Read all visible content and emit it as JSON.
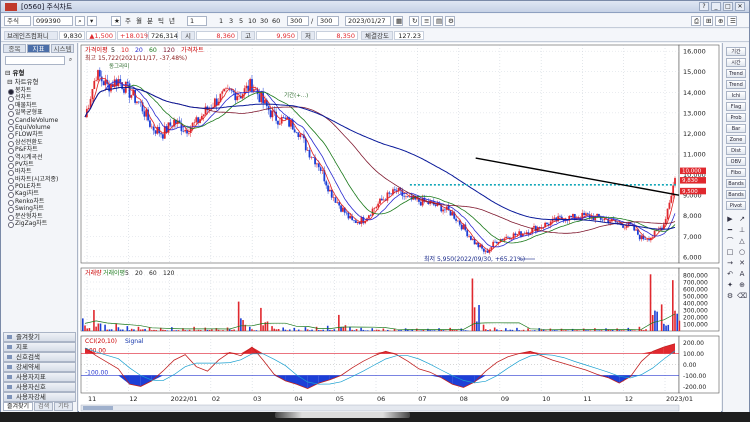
{
  "window": {
    "code": "[0560]",
    "title": "주식차트"
  },
  "toolbar": {
    "market": "주식",
    "stock_code": "099390",
    "period_type": "분",
    "periods": [
      "주",
      "월",
      "분",
      "틱",
      "년"
    ],
    "tick_count": "1",
    "intervals": [
      "1",
      "3",
      "5",
      "10",
      "30",
      "60"
    ],
    "count_value": "300",
    "count_total": "300",
    "date": "2023/01/27"
  },
  "quote": {
    "name": "브레인즈컴퍼니",
    "price": "9,830",
    "change": "▲1,500",
    "change_rate": "+18.01%",
    "volume": "726,314",
    "open_label": "시",
    "open": "8,360",
    "high_label": "고",
    "high": "9,950",
    "low_label": "저",
    "low": "8,350",
    "strength_label": "체결강도",
    "strength": "127.23"
  },
  "left_panel": {
    "tabs": [
      "종목",
      "지표",
      "시스템"
    ],
    "active_tab": "지표",
    "tree_header_1": "유형",
    "tree_header_2": "차트유형",
    "chart_types": [
      "봉차트",
      "선차트",
      "매물차트",
      "일목균형표",
      "CandleVolume",
      "EquiVolume",
      "FLOW차트",
      "삼선전환도",
      "P&F차트",
      "역시계곡선",
      "PV차트",
      "바차트",
      "바차트(시고저종)",
      "POLE차트",
      "Kagi차트",
      "Renko차트",
      "Swing차트",
      "분산형차트",
      "ZigZag차트"
    ],
    "selected_type": "봉차트",
    "menus": [
      "즐겨찾기",
      "지표",
      "신호검색",
      "강세약세",
      "사용자지표",
      "사용자신호",
      "사용자강세"
    ],
    "bottom_tabs": [
      "즐겨찾기",
      "검색",
      "기타"
    ]
  },
  "right_panel": {
    "buttons": [
      "기간",
      "시간",
      "Trend",
      "Trend",
      "Ichi",
      "Flag",
      "Prob",
      "Bar",
      "Zone",
      "Dist",
      "OBV",
      "Fibo",
      "Bands",
      "Bands",
      "Pivot"
    ],
    "symbols": [
      "▶",
      "↗",
      "━",
      "⊥",
      "⌒",
      "△",
      "□",
      "○",
      "→",
      "✕",
      "↶",
      "A",
      "✦",
      "⊕",
      "⚙",
      "⌫"
    ]
  },
  "chart_data": [
    {
      "type": "candlestick",
      "legend": [
        "가격이평",
        "5",
        "10",
        "20",
        "60",
        "120",
        "가격차트"
      ],
      "annotations": {
        "high": "최고 15,722(2021/11/17, -37.48%)",
        "low": "최저 5,950(2022/09/30, +65.21%)",
        "mid_label": "기간(+...)",
        "top_label": "동그라미"
      },
      "price_tags": [
        "10,000",
        "9,830",
        "9,500"
      ],
      "y_ticks": [
        "16,000",
        "15,000",
        "14,000",
        "13,000",
        "12,000",
        "11,000",
        "10,000",
        "9,000",
        "8,000",
        "7,000",
        "6,000"
      ],
      "ylim": [
        5700,
        16300
      ],
      "dashed_level": 9500,
      "trendline": [
        [
          0.66,
          10800
        ],
        [
          1.0,
          9000
        ]
      ],
      "close": [
        12800,
        14900,
        14300,
        14600,
        14000,
        13400,
        12300,
        12000,
        12600,
        12200,
        12500,
        13200,
        13700,
        14000,
        13900,
        14400,
        13500,
        12800,
        12600,
        12300,
        11200,
        10500,
        9200,
        8400,
        7700,
        7800,
        8400,
        8900,
        9200,
        8800,
        8700,
        8600,
        8400,
        8100,
        7400,
        6700,
        6200,
        6800,
        7000,
        7100,
        7300,
        7500,
        7700,
        7900,
        7900,
        8000,
        7900,
        7800,
        7600,
        7500,
        6900,
        7000,
        7600,
        9830
      ]
    },
    {
      "type": "bar",
      "legend": [
        "거래량",
        "거래이평",
        "5",
        "20",
        "60",
        "120"
      ],
      "y_ticks": [
        "800,000",
        "700,000",
        "600,000",
        "500,000",
        "400,000",
        "300,000",
        "200,000",
        "100,000"
      ],
      "ylim": [
        0,
        900000
      ],
      "values": [
        180000,
        300000,
        90000,
        110000,
        70000,
        60000,
        50000,
        45000,
        55000,
        40000,
        60000,
        48000,
        42000,
        50000,
        420000,
        60000,
        330000,
        70000,
        50000,
        45000,
        55000,
        60000,
        75000,
        230000,
        60000,
        45000,
        40000,
        35000,
        30000,
        38000,
        34000,
        32000,
        40000,
        45000,
        36000,
        750000,
        90000,
        50000,
        40000,
        45000,
        38000,
        42000,
        35000,
        33000,
        30000,
        35000,
        40000,
        38000,
        36000,
        45000,
        60000,
        810000,
        380000,
        726314
      ]
    },
    {
      "type": "line",
      "legend": [
        "CCI(20,10)",
        "Signal"
      ],
      "y_ticks": [
        "200.00",
        "100.00",
        "0.00",
        "-100.00",
        "-200.00"
      ],
      "levels": [
        "100.00",
        "-100.00"
      ],
      "ylim": [
        -260,
        260
      ],
      "values": [
        150,
        80,
        20,
        -40,
        -180,
        -200,
        -150,
        -60,
        40,
        90,
        -20,
        -60,
        40,
        110,
        80,
        160,
        40,
        -90,
        -150,
        -180,
        -220,
        -170,
        -140,
        -100,
        -30,
        30,
        80,
        120,
        90,
        30,
        -40,
        -70,
        -120,
        -180,
        -210,
        -160,
        -60,
        20,
        70,
        100,
        120,
        80,
        40,
        10,
        -20,
        -50,
        -90,
        -120,
        -170,
        -110,
        30,
        120,
        160,
        190
      ]
    }
  ],
  "x_axis": [
    "11",
    "12",
    "2022/01",
    "02",
    "03",
    "04",
    "05",
    "06",
    "07",
    "08",
    "09",
    "10",
    "11",
    "12",
    "2023/01"
  ],
  "colors": {
    "up": "#e0282e",
    "down": "#1c3fd6",
    "ma5": "#e02020",
    "ma10": "#2a2ad0",
    "ma20": "#1c7a1c",
    "ma60": "#801a30",
    "ma120": "#0a1a9a",
    "trendline": "#000000",
    "dashed": "#12a6b8"
  }
}
